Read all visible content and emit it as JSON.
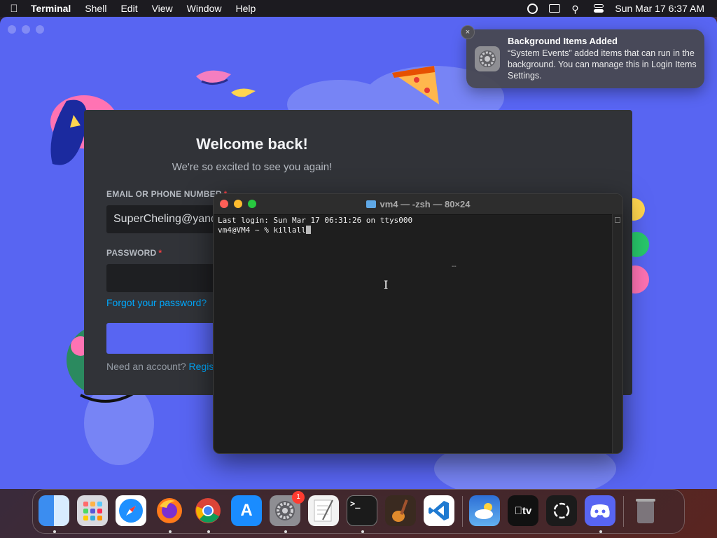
{
  "menubar": {
    "app_name": "Terminal",
    "menus": [
      "Shell",
      "Edit",
      "View",
      "Window",
      "Help"
    ],
    "clock": "Sun Mar 17  6:37 AM"
  },
  "discord": {
    "heading": "Welcome back!",
    "subheading": "We're so excited to see you again!",
    "email_label": "EMAIL OR PHONE NUMBER",
    "email_value": "SuperCheling@yande",
    "password_label": "PASSWORD",
    "required_mark": "*",
    "forgot_link": "Forgot your password?",
    "need_account": "Need an account?",
    "register_link": "Registe"
  },
  "terminal": {
    "title": "vm4 — -zsh — 80×24",
    "line1": "Last login: Sun Mar 17 06:31:26 on ttys000",
    "prompt": "vm4@VM4 ~ % killall",
    "stray_mark": "--"
  },
  "notification": {
    "title": "Background Items Added",
    "body": "“System Events” added items that can run in the background. You can manage this in Login Items Settings.",
    "close_glyph": "×"
  },
  "dock": {
    "items": [
      {
        "name": "Finder",
        "color": "#3b8df0"
      },
      {
        "name": "Launchpad",
        "color": "#d9d9de"
      },
      {
        "name": "Safari",
        "color": "#1e90ff"
      },
      {
        "name": "Firefox",
        "color": "#ff7a1a"
      },
      {
        "name": "Chrome",
        "color": "#e8e8e8"
      },
      {
        "name": "App Store",
        "color": "#1a8cff"
      },
      {
        "name": "System Settings",
        "color": "#8e8e93",
        "badge": "1"
      },
      {
        "name": "TextEdit",
        "color": "#f2f2f2"
      },
      {
        "name": "Terminal",
        "color": "#1b1b1b"
      },
      {
        "name": "GarageBand",
        "color": "#3a2a20"
      },
      {
        "name": "Visual Studio Code",
        "color": "#1f7ad1"
      },
      {
        "name": "Weather",
        "color": "#3f8fe0"
      },
      {
        "name": "TV",
        "color": "#111111",
        "label": "tv"
      },
      {
        "name": "ChatGPT",
        "color": "#1b1b1b"
      },
      {
        "name": "Discord",
        "color": "#5865f2"
      },
      {
        "name": "Trash",
        "color": "#6d6d72"
      }
    ]
  }
}
